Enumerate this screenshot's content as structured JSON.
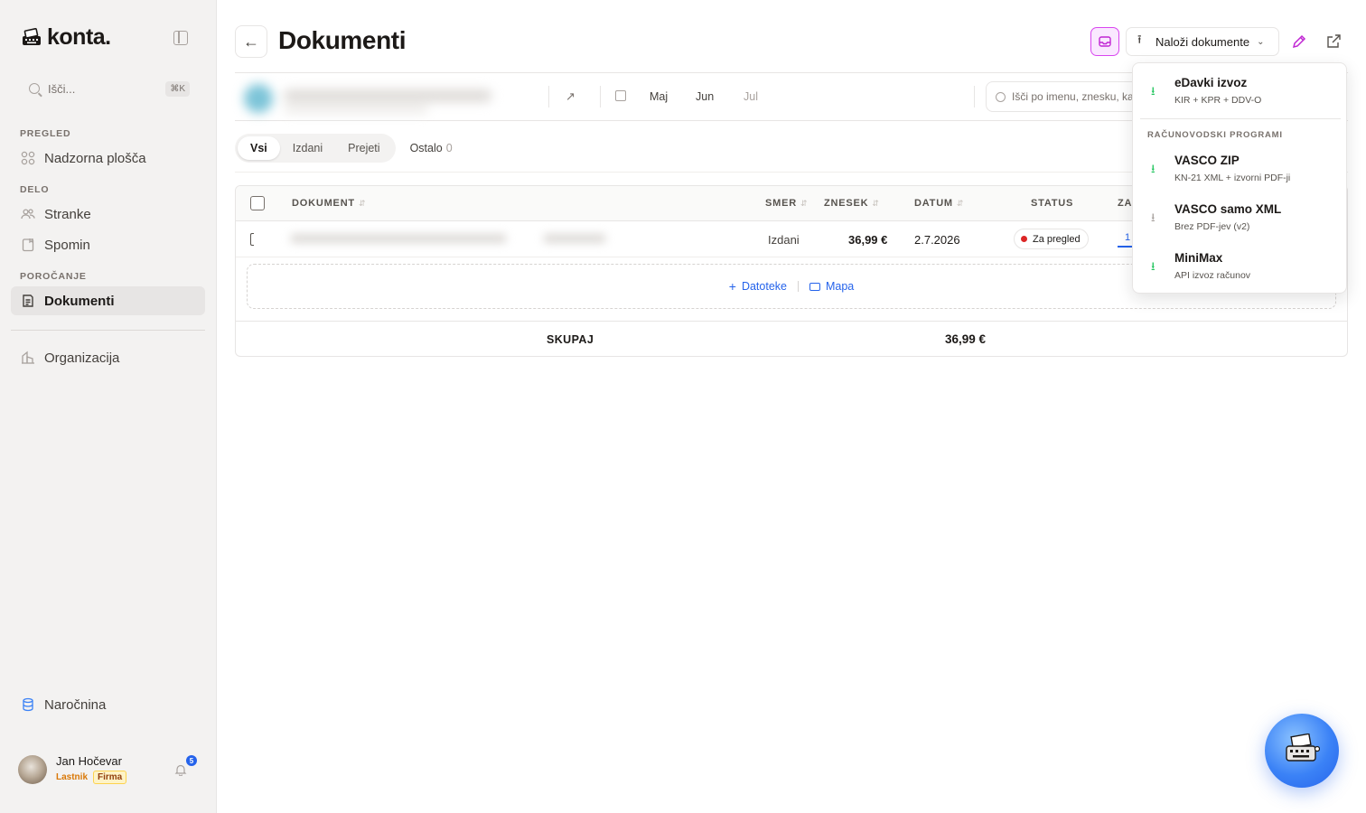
{
  "sidebar": {
    "logo_text": "konta.",
    "search": {
      "placeholder": "Išči...",
      "shortcut": "⌘K"
    },
    "sections": [
      {
        "label": "PREGLED",
        "items": [
          {
            "label": "Nadzorna plošča",
            "icon": "dashboard-icon"
          }
        ]
      },
      {
        "label": "DELO",
        "items": [
          {
            "label": "Stranke",
            "icon": "users-icon"
          },
          {
            "label": "Spomin",
            "icon": "memory-icon"
          }
        ]
      },
      {
        "label": "POROČANJE",
        "items": [
          {
            "label": "Dokumenti",
            "icon": "document-icon",
            "active": true
          }
        ]
      }
    ],
    "organization_label": "Organizacija",
    "subscription_label": "Naročnina",
    "user": {
      "name": "Jan Hočevar",
      "role": "Lastnik",
      "plan": "Firma",
      "notifications": "5"
    }
  },
  "header": {
    "title": "Dokumenti",
    "upload_label": "Naloži dokumente"
  },
  "filters": {
    "months": [
      "Maj",
      "Jun",
      "Jul"
    ],
    "search_placeholder": "Išči po imenu, znesku, ka"
  },
  "tabs": {
    "segments": [
      "Vsi",
      "Izdani",
      "Prejeti"
    ],
    "active": "Vsi",
    "other_label": "Ostalo",
    "other_count": "0"
  },
  "table": {
    "columns": {
      "document": "DOKUMENT",
      "direction": "SMER",
      "amount": "ZNESEK",
      "date": "DATUM",
      "status": "STATUS",
      "extra": "ZA"
    },
    "rows": [
      {
        "direction": "Izdani",
        "amount": "36,99 €",
        "date": "2.7.2026",
        "status": "Za pregled",
        "extra": "1"
      }
    ],
    "dropzone": {
      "files_label": "Datoteke",
      "folder_label": "Mapa"
    },
    "footer": {
      "label": "SKUPAJ",
      "total": "36,99 €"
    }
  },
  "export_menu": {
    "primary": {
      "title": "eDavki izvoz",
      "subtitle": "KIR + KPR + DDV-O"
    },
    "section_label": "RAČUNOVODSKI PROGRAMI",
    "items": [
      {
        "title": "VASCO ZIP",
        "subtitle": "KN-21 XML + izvorni PDF-ji"
      },
      {
        "title": "VASCO samo XML",
        "subtitle": "Brez PDF-jev (v2)"
      },
      {
        "title": "MiniMax",
        "subtitle": "API izvoz računov"
      }
    ]
  },
  "colors": {
    "accent": "#2563eb",
    "inbox": "#d946ef",
    "success": "#22c55e",
    "status_dot": "#dc2626",
    "plan_tag": "#d97706"
  }
}
